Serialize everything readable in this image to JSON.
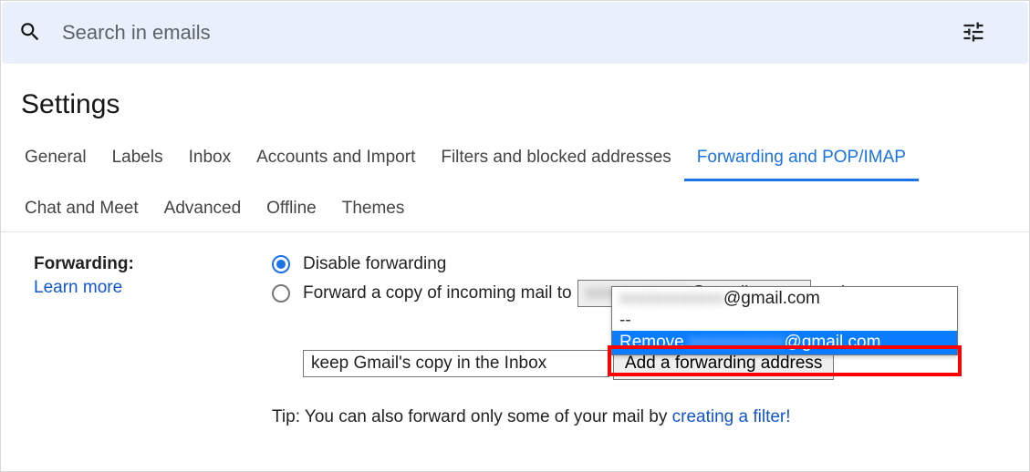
{
  "search": {
    "placeholder": "Search in emails"
  },
  "page_title": "Settings",
  "tabs": {
    "general": "General",
    "labels": "Labels",
    "inbox": "Inbox",
    "accounts": "Accounts and Import",
    "filters": "Filters and blocked addresses",
    "forwarding": "Forwarding and POP/IMAP",
    "chat": "Chat and Meet",
    "advanced": "Advanced",
    "offline": "Offline",
    "themes": "Themes"
  },
  "forwarding": {
    "label": "Forwarding:",
    "learn_more": "Learn more",
    "disable": "Disable forwarding",
    "forward_copy": "Forward a copy of incoming mail to",
    "selected_email_suffix": "@gmail.com",
    "and": "and",
    "keep_copy": "keep Gmail's copy in the Inbox",
    "add_button": "Add a forwarding address",
    "tip_prefix": "Tip: You can also forward only some of your mail by ",
    "tip_link": "creating a filter!"
  },
  "dropdown": {
    "opt1_suffix": "@gmail.com",
    "separator": "--",
    "remove_prefix": "Remove ",
    "remove_suffix": "@gmail.com"
  }
}
